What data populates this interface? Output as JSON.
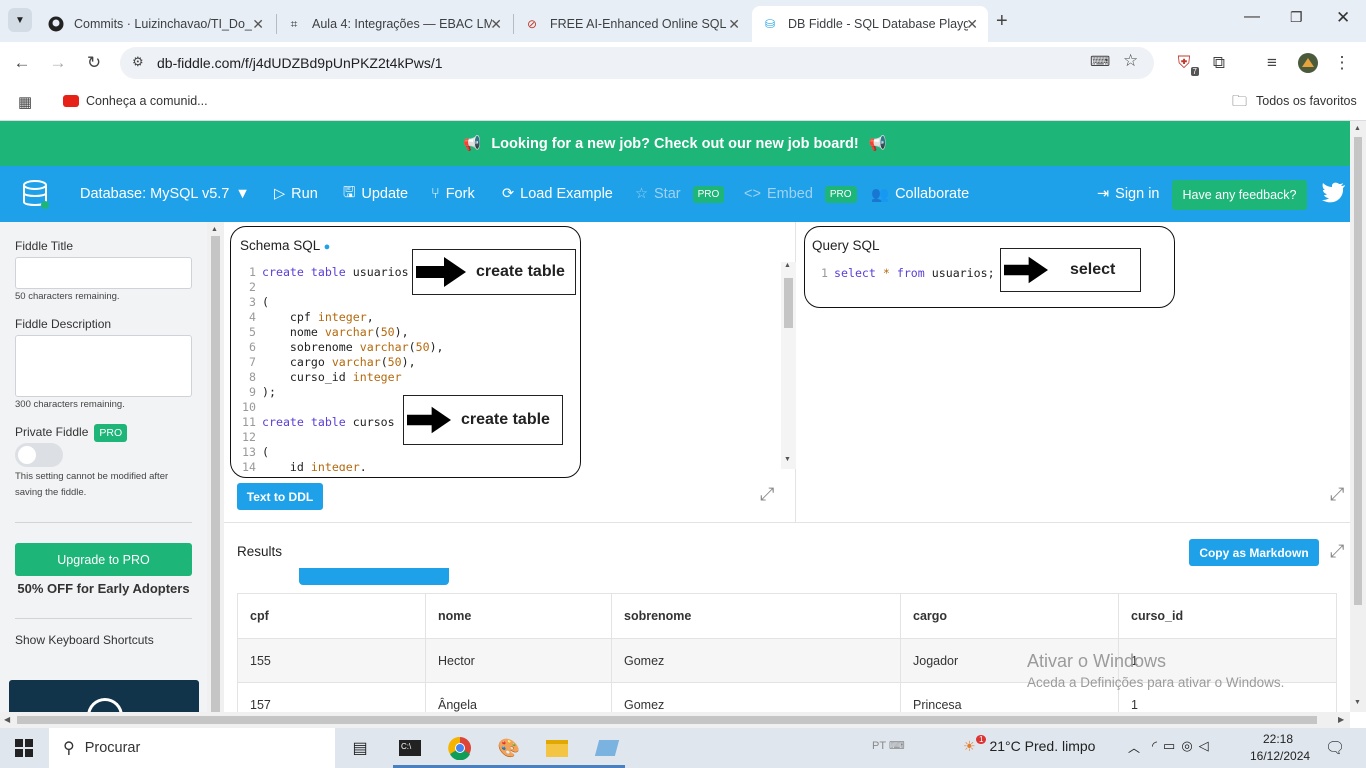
{
  "browser": {
    "tabs": [
      {
        "title": "Commits · Luizinchavao/TI_Do_",
        "icon": "github-icon"
      },
      {
        "title": "Aula 4: Integrações — EBAC LM",
        "icon": "ebac-icon"
      },
      {
        "title": "FREE AI-Enhanced Online SQL S",
        "icon": "sql-editor-icon"
      },
      {
        "title": "DB Fiddle - SQL Database Playg",
        "icon": "db-fiddle-icon",
        "active": true
      }
    ],
    "url": "db-fiddle.com/f/j4dUDZBd9pUnPKZ2t4kPws/1",
    "extension_badge": "7",
    "bookmarks": {
      "item": "Conheça a comunid...",
      "all": "Todos os favoritos"
    }
  },
  "banner": {
    "text": "Looking for a new job? Check out our new job board!"
  },
  "navbar": {
    "database": "Database: MySQL v5.7",
    "run": "Run",
    "update": "Update",
    "fork": "Fork",
    "load_example": "Load Example",
    "star": "Star",
    "embed": "Embed",
    "pro": "PRO",
    "collaborate": "Collaborate",
    "sign_in": "Sign in",
    "feedback": "Have any feedback?"
  },
  "sidebar": {
    "fiddle_title_label": "Fiddle Title",
    "title_remaining": "50 characters remaining.",
    "description_label": "Fiddle Description",
    "description_remaining": "300 characters remaining.",
    "private_label": "Private Fiddle",
    "pro": "PRO",
    "private_note_1": "This setting cannot be modified after",
    "private_note_2": "saving the fiddle.",
    "upgrade": "Upgrade to PRO",
    "discount": "50% OFF for Early Adopters",
    "shortcuts": "Show Keyboard Shortcuts"
  },
  "schema": {
    "title": "Schema SQL",
    "lines": [
      {
        "n": "1",
        "tokens": [
          [
            "kw",
            "create table "
          ],
          [
            "",
            "usuarios"
          ]
        ]
      },
      {
        "n": "2",
        "tokens": []
      },
      {
        "n": "3",
        "tokens": [
          [
            "",
            "("
          ]
        ]
      },
      {
        "n": "4",
        "tokens": [
          [
            "",
            "    cpf "
          ],
          [
            "ty",
            "integer"
          ],
          [
            "",
            ","
          ]
        ]
      },
      {
        "n": "5",
        "tokens": [
          [
            "",
            "    nome "
          ],
          [
            "ty",
            "varchar"
          ],
          [
            "",
            "("
          ],
          [
            "ty",
            "50"
          ],
          [
            "",
            "),"
          ]
        ]
      },
      {
        "n": "6",
        "tokens": [
          [
            "",
            "    sobrenome "
          ],
          [
            "ty",
            "varchar"
          ],
          [
            "",
            "("
          ],
          [
            "ty",
            "50"
          ],
          [
            "",
            "),"
          ]
        ]
      },
      {
        "n": "7",
        "tokens": [
          [
            "",
            "    cargo "
          ],
          [
            "ty",
            "varchar"
          ],
          [
            "",
            "("
          ],
          [
            "ty",
            "50"
          ],
          [
            "",
            "),"
          ]
        ]
      },
      {
        "n": "8",
        "tokens": [
          [
            "",
            "    curso_id "
          ],
          [
            "ty",
            "integer"
          ]
        ]
      },
      {
        "n": "9",
        "tokens": [
          [
            "",
            ");"
          ]
        ]
      },
      {
        "n": "10",
        "tokens": []
      },
      {
        "n": "11",
        "tokens": [
          [
            "kw",
            "create table "
          ],
          [
            "",
            "cursos"
          ]
        ]
      },
      {
        "n": "12",
        "tokens": []
      },
      {
        "n": "13",
        "tokens": [
          [
            "",
            "("
          ]
        ]
      },
      {
        "n": "14",
        "tokens": [
          [
            "",
            "    id "
          ],
          [
            "ty",
            "integer"
          ],
          [
            "",
            "."
          ]
        ]
      }
    ],
    "annotation_1": "create table",
    "annotation_2": "create table",
    "text_to_ddl": "Text to DDL"
  },
  "query": {
    "title": "Query SQL",
    "line_no": "1",
    "tokens": [
      [
        "kw",
        "select "
      ],
      [
        "ty",
        "* "
      ],
      [
        "kw",
        "from "
      ],
      [
        "",
        "usuarios;"
      ]
    ],
    "annotation": "select"
  },
  "results": {
    "title": "Results",
    "copy": "Copy as Markdown",
    "columns": [
      "cpf",
      "nome",
      "sobrenome",
      "cargo",
      "curso_id"
    ],
    "rows": [
      [
        "155",
        "Hector",
        "Gomez",
        "Jogador",
        "1"
      ],
      [
        "157",
        "Ângela",
        "Gomez",
        "Princesa",
        "1"
      ]
    ]
  },
  "watermark": {
    "title": "Ativar o Windows",
    "subtitle": "Aceda a Definições para ativar o Windows."
  },
  "taskbar": {
    "search": "Procurar",
    "lang": "PT",
    "weather": "21°C  Pred. limpo",
    "weather_badge": "1",
    "time": "22:18",
    "date": "16/12/2024"
  },
  "colors": {
    "green": "#1eb579",
    "blue": "#1ea1e9"
  }
}
